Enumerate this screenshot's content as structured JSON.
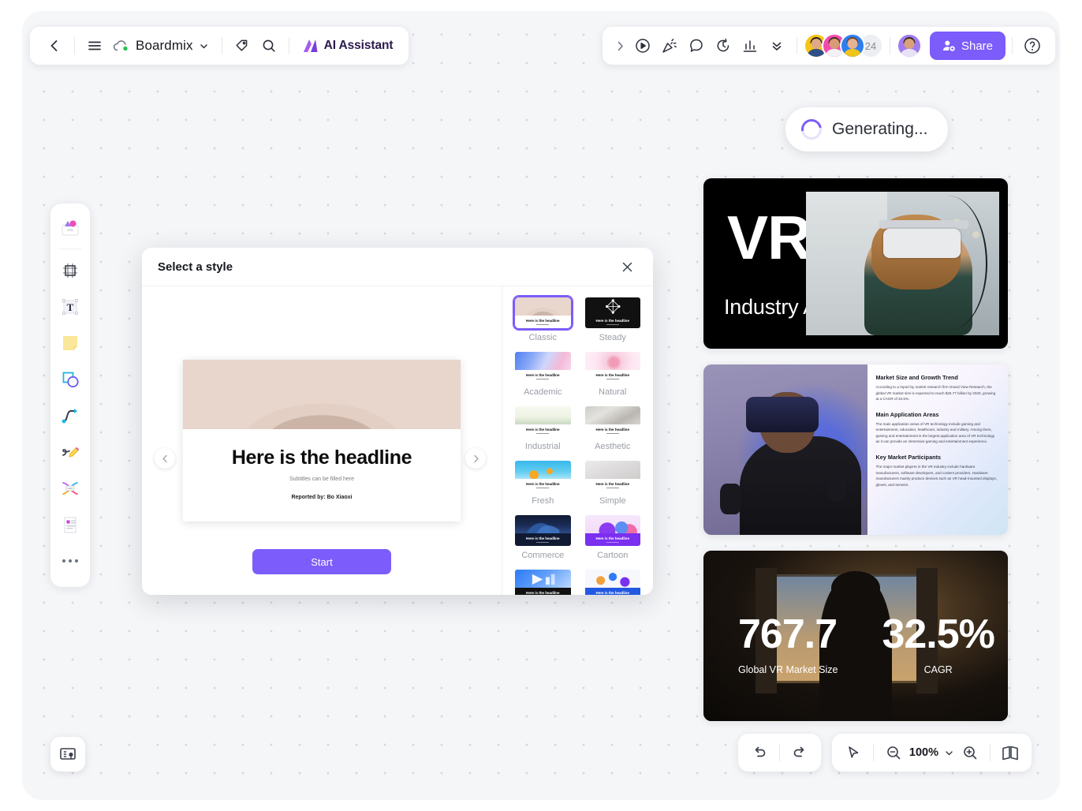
{
  "topbar": {
    "back_label": "back",
    "menu_label": "menu",
    "board_name": "Boardmix",
    "tag_label": "tag",
    "search_label": "search",
    "ai_assistant_label": "AI Assistant",
    "expand_label": "expand",
    "present_label": "present",
    "celebrate_label": "celebrate",
    "comment_label": "comment",
    "timer_label": "timer",
    "chart_label": "chart",
    "more_label": "more",
    "collaborator_count": "24",
    "share_label": "Share",
    "help_label": "help"
  },
  "toolrail": {
    "items": [
      {
        "name": "templates",
        "label": "Templates"
      },
      {
        "name": "frame",
        "label": "Frame"
      },
      {
        "name": "text",
        "label": "Text"
      },
      {
        "name": "sticky-note",
        "label": "Sticky note"
      },
      {
        "name": "shapes",
        "label": "Shapes"
      },
      {
        "name": "connector",
        "label": "Connector"
      },
      {
        "name": "pen",
        "label": "Pen"
      },
      {
        "name": "mindmap",
        "label": "Mind map"
      },
      {
        "name": "document",
        "label": "Document"
      },
      {
        "name": "more",
        "label": "More"
      }
    ]
  },
  "status": {
    "generating_label": "Generating..."
  },
  "modal": {
    "title": "Select a style",
    "close_label": "close",
    "start_label": "Start",
    "prev_label": "previous style",
    "next_label": "next style",
    "preview": {
      "headline": "Here is the headline",
      "subtitle": "Subtitles can be filled here",
      "reporter": "Reported by:  Bo Xiaoxi"
    },
    "thumb_headline": "Here is the headline",
    "styles": [
      {
        "label": "Classic",
        "selected": true
      },
      {
        "label": "Steady",
        "selected": false
      },
      {
        "label": "Academic",
        "selected": false
      },
      {
        "label": "Natural",
        "selected": false
      },
      {
        "label": "Industrial",
        "selected": false
      },
      {
        "label": "Aesthetic",
        "selected": false
      },
      {
        "label": "Fresh",
        "selected": false
      },
      {
        "label": "Simple",
        "selected": false
      },
      {
        "label": "Commerce",
        "selected": false
      },
      {
        "label": "Cartoon",
        "selected": false
      },
      {
        "label": "",
        "selected": false
      },
      {
        "label": "",
        "selected": false
      }
    ]
  },
  "slides": {
    "slide1": {
      "title": "VR",
      "subtitle": "Industry Analysis Report"
    },
    "slide2": {
      "sections": [
        {
          "heading": "Market Size and Growth Trend",
          "body": "According to a report by market research firm Grand View Research, the global VR market size is expected to reach $26.77 billion by 2028, growing at a CAGR of 32.5%."
        },
        {
          "heading": "Main Application Areas",
          "body": "The main application areas of VR technology include gaming and entertainment, education, healthcare, industry and military. Among them, gaming and entertainment is the largest application area of VR technology as it can provide an immersive gaming and entertainment experience."
        },
        {
          "heading": "Key Market Participants",
          "body": "The major market players in the VR industry include hardware manufacturers, software developers, and content providers. Hardware manufacturers mainly produce devices such as VR head-mounted displays, gloves, and sensors."
        }
      ]
    },
    "slide3": {
      "stat1_value": "767.7",
      "stat1_label": "Global VR Market Size",
      "stat2_value": "32.5%",
      "stat2_label": "CAGR"
    }
  },
  "bottombar": {
    "undo_label": "undo",
    "redo_label": "redo",
    "cursor_label": "cursor",
    "zoom_out_label": "zoom out",
    "zoom_value": "100%",
    "zoom_menu_label": "zoom options",
    "zoom_in_label": "zoom in",
    "minimap_label": "minimap",
    "panel_label": "slides panel"
  },
  "colors": {
    "accent": "#7c5cfa",
    "canvas": "#f5f6f8",
    "slide_dark": "#000000"
  }
}
